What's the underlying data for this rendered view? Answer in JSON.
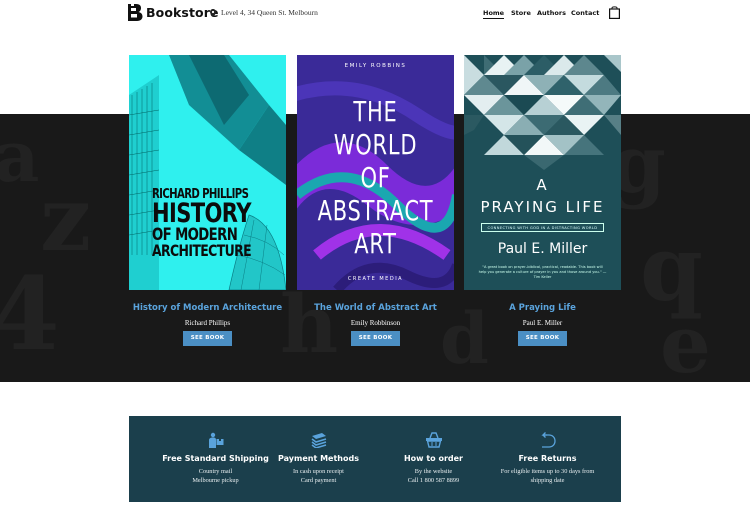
{
  "brand": {
    "name": "Bookstore"
  },
  "header": {
    "address": "Level 4, 34 Queen St. Melbourn",
    "nav": [
      "Home",
      "Store",
      "Authors",
      "Contact"
    ],
    "cart_icon": "shopping-bag-icon"
  },
  "books": [
    {
      "title": "History of Modern Architecture",
      "author": "Richard Phillips",
      "button": "SEE BOOK",
      "cover": {
        "author": "RICHARD PHILLIPS",
        "line1": "HISTORY",
        "line2": "OF MODERN",
        "line3": "ARCHITECTURE",
        "color": "#2ff0ee"
      }
    },
    {
      "title": "The World of Abstract Art",
      "author": "Emily Robbinson",
      "button": "SEE BOOK",
      "cover": {
        "author": "EMILY ROBBINS",
        "line1": "THE",
        "line2": "WORLD",
        "line3": "OF",
        "line4": "ABSTRACT",
        "line5": "ART",
        "publisher": "CREATE MEDIA",
        "color": "#3a2a98"
      }
    },
    {
      "title": "A Praying Life",
      "author": "Paul E. Miller",
      "button": "SEE BOOK",
      "cover": {
        "line1": "A",
        "line2": "PRAYING LIFE",
        "tagline": "CONNECTING WITH GOD IN A DISTRACTING WORLD",
        "author": "Paul E. Miller",
        "quote": "\"A great book on prayer–biblical, practical, readable. This book will help you generate a culture of prayer in you and those around you.\" —Tim Keller",
        "color": "#1e4f58"
      }
    }
  ],
  "features": [
    {
      "icon": "delivery-man-icon",
      "title": "Free Standard Shipping",
      "line1": "Country mail",
      "line2": "Melbourne pickup"
    },
    {
      "icon": "money-stack-icon",
      "title": "Payment Methods",
      "line1": "In cash upon receipt",
      "line2": "Card payment"
    },
    {
      "icon": "basket-icon",
      "title": "How to order",
      "line1": "By the website",
      "line2": "Call 1 800 587 8899"
    },
    {
      "icon": "return-arrow-icon",
      "title": "Free Returns",
      "line1": "For eligible items up to 30 days from",
      "line2": "shipping date"
    }
  ],
  "colors": {
    "accent": "#4b8fc4",
    "link": "#5aa3dc",
    "band": "#191919",
    "panel": "#1b3f4c"
  }
}
